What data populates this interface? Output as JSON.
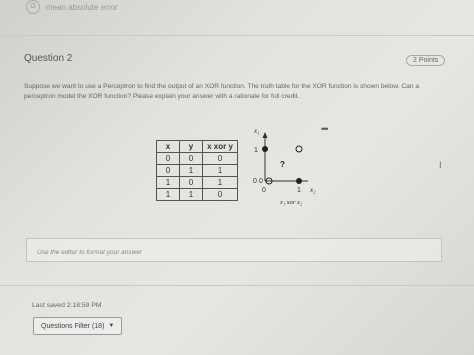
{
  "previous_question": {
    "marker": "G",
    "text": "mean absolute error"
  },
  "question": {
    "title": "Question 2",
    "points": "2 Points",
    "prompt": "Suppose we want to use a Perceptron to find the output of an XOR function. The truth table for the XOR function is shown below. Can a perceptron model the XOR function? Please explain your answer with a rationale for full credit."
  },
  "truth_table": {
    "headers": [
      "x",
      "y",
      "x xor y"
    ],
    "rows": [
      [
        "0",
        "0",
        "0"
      ],
      [
        "0",
        "1",
        "1"
      ],
      [
        "1",
        "0",
        "1"
      ],
      [
        "1",
        "1",
        "0"
      ]
    ]
  },
  "plot": {
    "y_axis_label": "x₁",
    "x_axis_label": "x₂",
    "caption": "x₁ xor x₂",
    "tick_1_y": "1",
    "tick_0_y": "0",
    "tick_0_x": "0",
    "tick_1_x": "1",
    "origin_label": "0",
    "unknown_label": "?"
  },
  "editor": {
    "placeholder": "Use the editor to format your answer"
  },
  "footer": {
    "last_saved": "Last saved 2:18:59 PM",
    "filter_label": "Questions Filter (18)"
  },
  "icons": {
    "more": "more-icon",
    "caret": "caret-down-icon",
    "text_cursor": "text-cursor-icon"
  }
}
